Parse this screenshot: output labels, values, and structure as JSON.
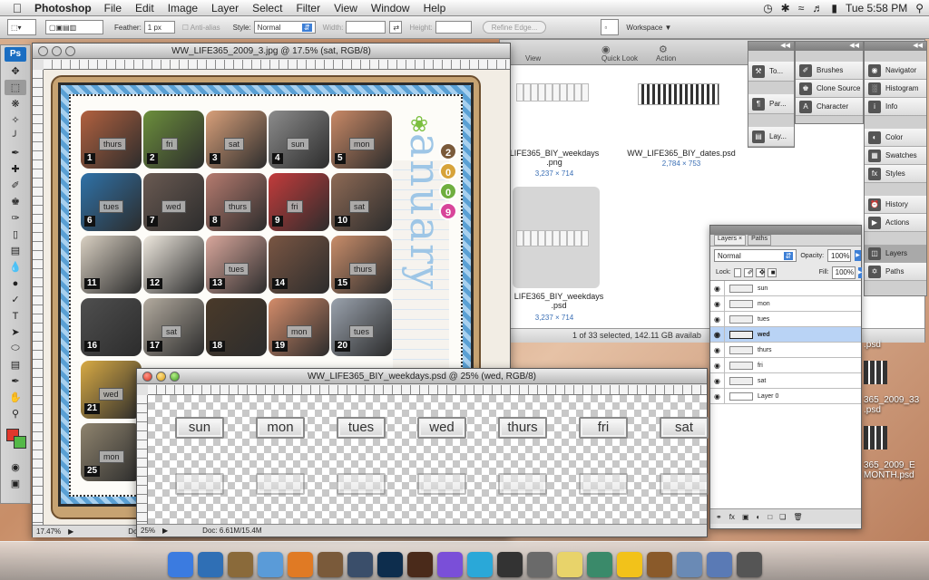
{
  "menubar": {
    "app_name": "Photoshop",
    "items": [
      "File",
      "Edit",
      "Image",
      "Layer",
      "Select",
      "Filter",
      "View",
      "Window",
      "Help"
    ],
    "clock": "Tue 5:58 PM"
  },
  "options_bar": {
    "feather_label": "Feather:",
    "feather_value": "1 px",
    "antialias_label": "Anti-alias",
    "style_label": "Style:",
    "style_value": "Normal",
    "width_label": "Width:",
    "height_label": "Height:",
    "refine_edge": "Refine Edge...",
    "workspace": "Workspace"
  },
  "toolbox": {
    "logo": "Ps"
  },
  "doc1": {
    "title": "WW_LIFE365_2009_3.jpg @ 17.5% (sat, RGB/8)",
    "zoom": "17.47%",
    "doc_label": "Doc",
    "side_text": "anuary",
    "year_digits": [
      "2",
      "0",
      "0",
      "9"
    ],
    "photos": [
      {
        "num": "1",
        "tag": "thurs",
        "color": "#b2613f"
      },
      {
        "num": "2",
        "tag": "fri",
        "color": "#6c8f3c"
      },
      {
        "num": "3",
        "tag": "sat",
        "color": "#d9a07a"
      },
      {
        "num": "4",
        "tag": "sun",
        "color": "#8c8c8c"
      },
      {
        "num": "5",
        "tag": "mon",
        "color": "#c98966"
      },
      {
        "num": "6",
        "tag": "tues",
        "color": "#2f72a8"
      },
      {
        "num": "7",
        "tag": "wed",
        "color": "#6a5a52"
      },
      {
        "num": "8",
        "tag": "thurs",
        "color": "#b67b6f"
      },
      {
        "num": "9",
        "tag": "fri",
        "color": "#c33b3b"
      },
      {
        "num": "10",
        "tag": "sat",
        "color": "#8e6a55"
      },
      {
        "num": "11",
        "tag": "",
        "color": "#d9d0c2"
      },
      {
        "num": "12",
        "tag": "",
        "color": "#efe9df"
      },
      {
        "num": "13",
        "tag": "tues",
        "color": "#d9a79c"
      },
      {
        "num": "14",
        "tag": "",
        "color": "#7a5643"
      },
      {
        "num": "15",
        "tag": "thurs",
        "color": "#c98d6a"
      },
      {
        "num": "16",
        "tag": "",
        "color": "#4f4f4f"
      },
      {
        "num": "17",
        "tag": "sat",
        "color": "#b3ab9f"
      },
      {
        "num": "18",
        "tag": "",
        "color": "#4a3a2a"
      },
      {
        "num": "19",
        "tag": "mon",
        "color": "#d48c6a"
      },
      {
        "num": "20",
        "tag": "tues",
        "color": "#9aa2ad"
      },
      {
        "num": "21",
        "tag": "wed",
        "color": "#d8aa44"
      },
      {
        "num": "25",
        "tag": "mon",
        "color": "#8f846e"
      }
    ]
  },
  "doc2": {
    "title": "WW_LIFE365_BIY_weekdays.psd @ 25% (wed, RGB/8)",
    "zoom": "25%",
    "doc_info": "Doc: 6.61M/15.4M",
    "days": [
      "sun",
      "mon",
      "tues",
      "wed",
      "thurs",
      "fri",
      "sat"
    ]
  },
  "finder": {
    "view": "View",
    "quick_look": "Quick Look",
    "action": "Action",
    "files": [
      {
        "name": "LIFE365_BIY_weekdays\n.png",
        "size": "3,237 × 714"
      },
      {
        "name": "WW_LIFE365_BIY_dates.psd",
        "size": "2,784 × 753"
      },
      {
        "name": "LIFE365_BIY_weekdays\n.psd",
        "size": "3,237 × 714"
      }
    ],
    "status": "1 of 33 selected, 142.11 GB availab",
    "desktop_labels": [
      "365_2009_33\n.psd",
      "365_2009_E\nMONTH.psd",
      ".psd"
    ]
  },
  "panels": {
    "col1": [
      "To...",
      "Par...",
      "Lay..."
    ],
    "col2": [
      "Brushes",
      "Clone Source",
      "Character"
    ],
    "col3a": [
      "Navigator",
      "Histogram",
      "Info"
    ],
    "col3b": [
      "Color",
      "Swatches",
      "Styles"
    ],
    "col3c": [
      "History",
      "Actions"
    ],
    "col3d": [
      "Layers",
      "Paths"
    ]
  },
  "layers_panel": {
    "tabs": [
      "Layers",
      "Paths"
    ],
    "blend_mode": "Normal",
    "opacity_label": "Opacity:",
    "opacity_value": "100%",
    "lock_label": "Lock:",
    "fill_label": "Fill:",
    "fill_value": "100%",
    "layers": [
      "sun",
      "mon",
      "tues",
      "wed",
      "thurs",
      "fri",
      "sat",
      "Layer 0"
    ],
    "active_layer": "wed"
  },
  "dock": [
    "Finder",
    "Safari",
    "Mail",
    "Preview",
    "Firefox",
    "iPhoto",
    "Lr",
    "Ps",
    "Br",
    "iTunes",
    "Flip",
    "Movie",
    "Chess",
    "Bulb",
    "Utility",
    "Duck",
    "Guitar",
    "Folder",
    "Downloads",
    "Trash"
  ]
}
